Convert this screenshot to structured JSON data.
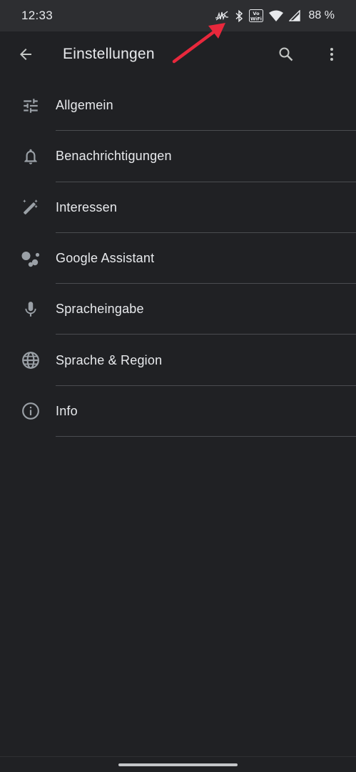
{
  "status_bar": {
    "time": "12:33",
    "battery": "88 %",
    "icons": [
      "vibrate-icon",
      "bluetooth-icon",
      "vowifi-icon",
      "wifi-icon",
      "signal-icon"
    ]
  },
  "app_bar": {
    "title": "Einstellungen",
    "back_icon": "arrow-back-icon",
    "search_icon": "search-icon",
    "more_icon": "more-vert-icon"
  },
  "settings": [
    {
      "label": "Allgemein",
      "icon": "tune-icon"
    },
    {
      "label": "Benachrichtigungen",
      "icon": "bell-icon"
    },
    {
      "label": "Interessen",
      "icon": "magic-wand-icon"
    },
    {
      "label": "Google Assistant",
      "icon": "assistant-icon"
    },
    {
      "label": "Spracheingabe",
      "icon": "mic-icon"
    },
    {
      "label": "Sprache & Region",
      "icon": "globe-icon"
    },
    {
      "label": "Info",
      "icon": "info-icon"
    }
  ],
  "colors": {
    "background": "#202124",
    "status_bar": "#2d2e31",
    "text": "#e8eaed",
    "icon": "#9aa0a6",
    "divider": "#4a4c50",
    "annotation_arrow": "#e8283c"
  }
}
